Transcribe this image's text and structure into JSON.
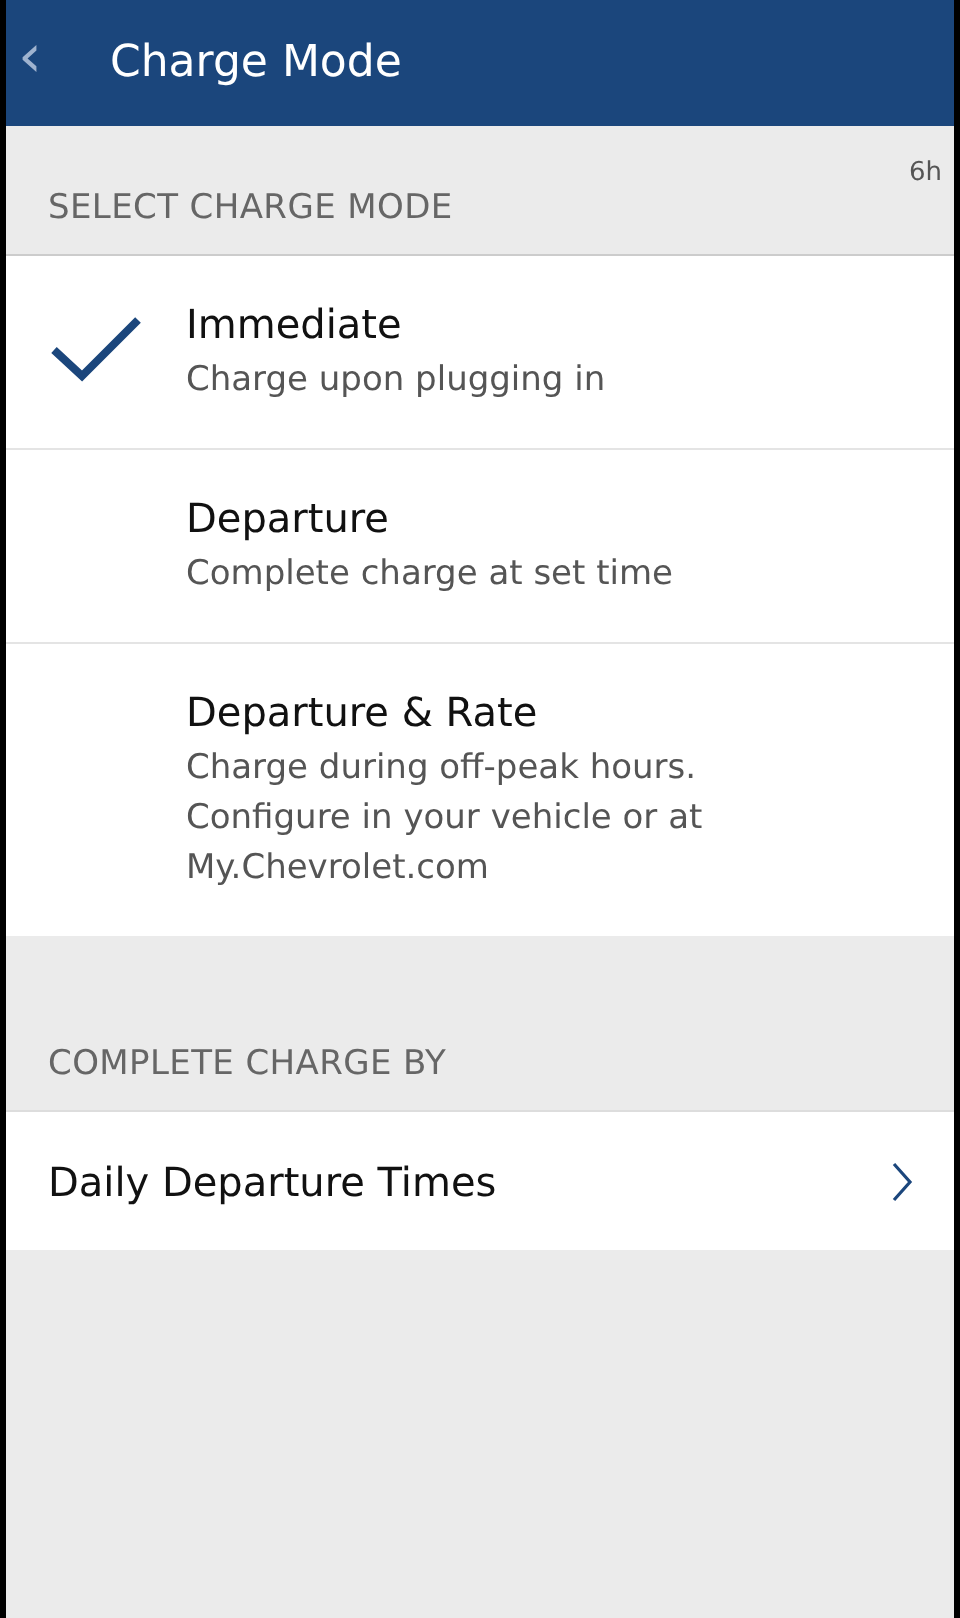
{
  "header": {
    "back": "‹",
    "title": "Charge Mode"
  },
  "age": "6h",
  "sections": [
    {
      "title": "SELECT CHARGE MODE",
      "kind": "modes",
      "items": [
        {
          "title": "Immediate",
          "subtitle": "Charge upon plugging in",
          "selected": true
        },
        {
          "title": "Departure",
          "subtitle": "Complete charge at set time",
          "selected": false
        },
        {
          "title": "Departure & Rate",
          "subtitle": "Charge during off-peak hours. Configure in your vehicle or at My.Chevrolet.com",
          "selected": false
        }
      ]
    },
    {
      "title": "COMPLETE CHARGE BY",
      "kind": "links",
      "items": [
        {
          "title": "Daily Departure Times"
        }
      ]
    }
  ]
}
